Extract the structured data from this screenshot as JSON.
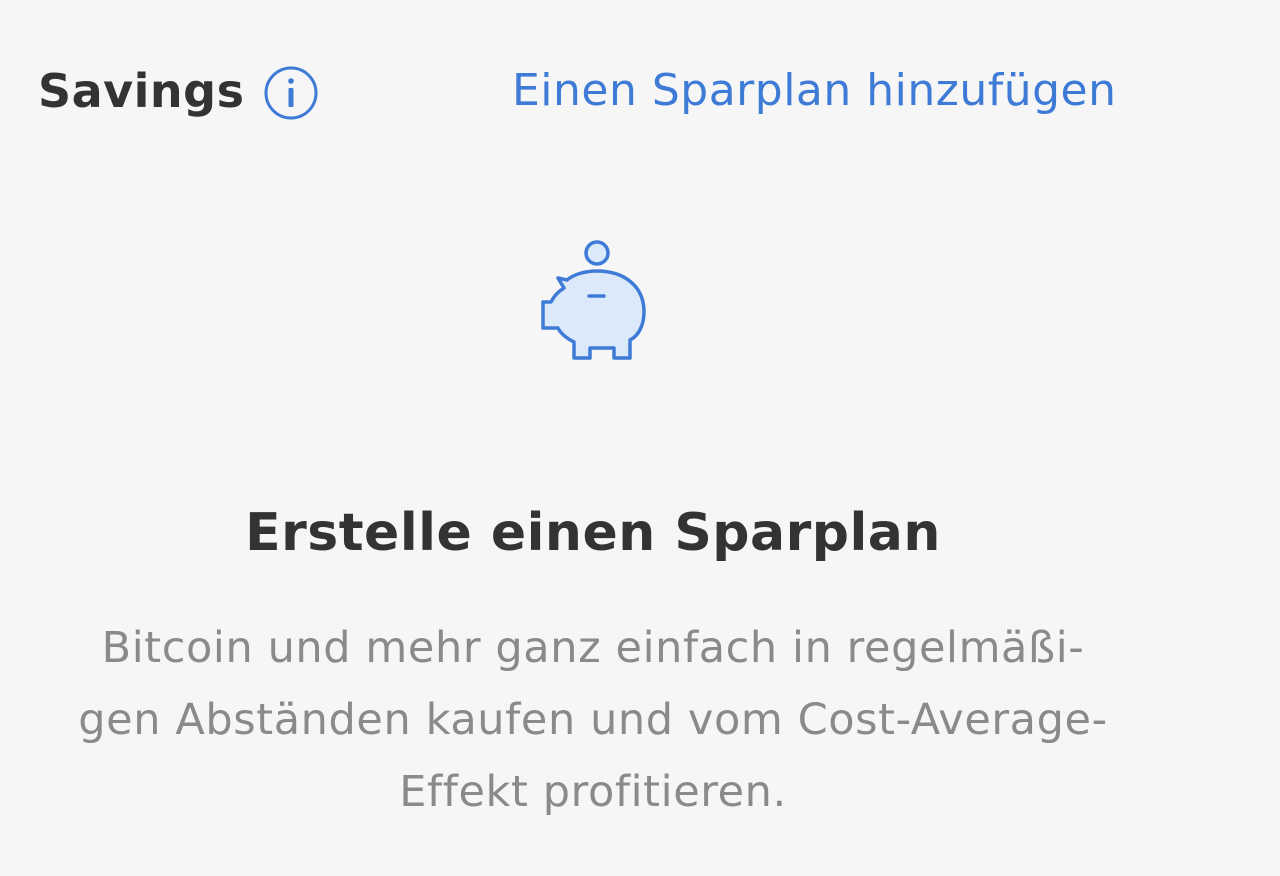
{
  "header": {
    "title": "Savings",
    "info_icon": "info-circle-icon",
    "add_plan_label": "Einen Sparplan hinzufügen"
  },
  "empty_state": {
    "icon": "piggy-bank-icon",
    "title": "Erstelle einen Sparplan",
    "description_lines": [
      "Bitcoin und mehr ganz einfach in regelmäßi-",
      "gen Abständen kaufen und vom Cost-Average-",
      "Effekt profitieren."
    ]
  },
  "colors": {
    "accent": "#3e7bd6",
    "background": "#f6f6f6",
    "heading": "#333333",
    "body_text": "#8a8a8a",
    "icon_fill": "#dbe9fb"
  }
}
